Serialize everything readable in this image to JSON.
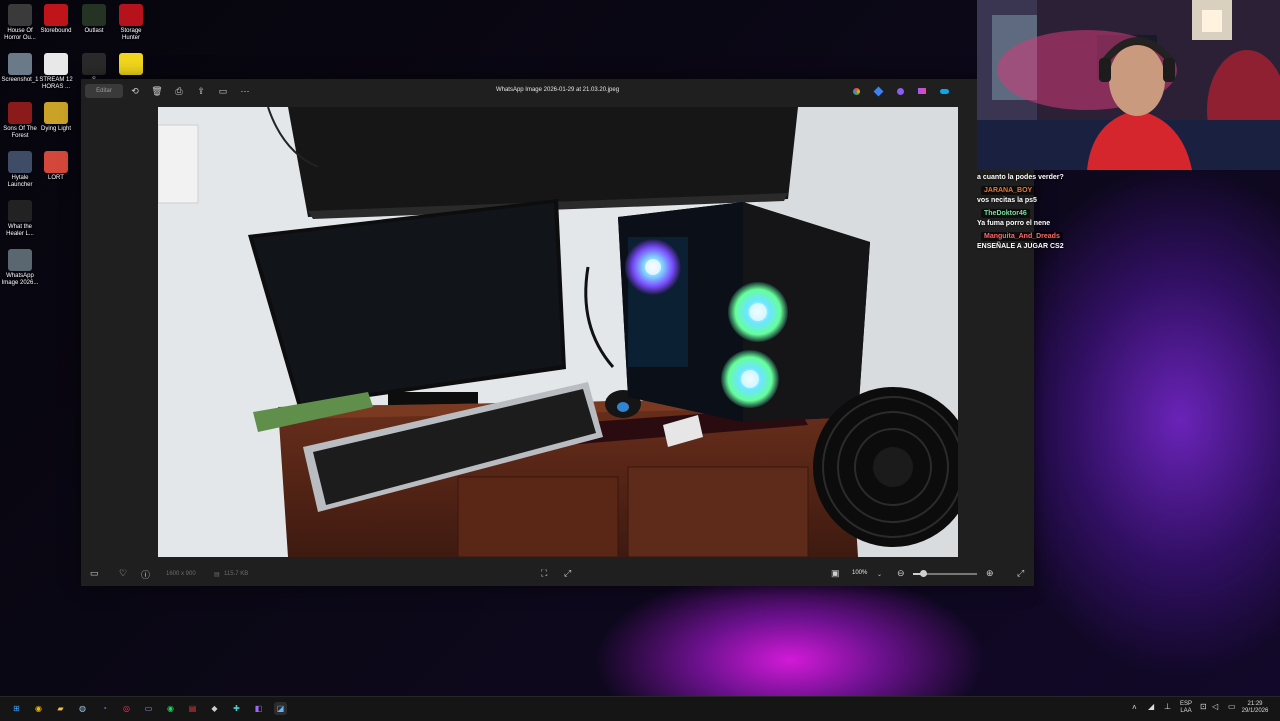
{
  "desktop": {
    "icons": [
      {
        "label": "House Of Horror Ou...",
        "icon": "house-of-horror-icon",
        "color": "#3a3a3a"
      },
      {
        "label": "Storebound",
        "icon": "storebound-icon",
        "color": "#c0141b"
      },
      {
        "label": "Outlast",
        "icon": "outlast-icon",
        "color": "#243324"
      },
      {
        "label": "Storage Hunter",
        "icon": "storage-hunter-icon",
        "color": "#b5121b"
      },
      {
        "label": "Screenshot_1",
        "icon": "screenshot-icon",
        "color": "#6b7a88"
      },
      {
        "label": "STREAM 12 HORAS ...",
        "icon": "document-icon",
        "color": "#e8e8e8"
      },
      {
        "label": "S",
        "icon": "app-icon",
        "color": "#2a2a2a"
      },
      {
        "label": "",
        "icon": "dc-icon",
        "color": "#f0d61c"
      },
      {
        "label": "Sons Of The Forest",
        "icon": "sons-of-the-forest-icon",
        "color": "#8b1a1a"
      },
      {
        "label": "Dying Light",
        "icon": "dying-light-icon",
        "color": "#c9a227"
      },
      {
        "label": "Hytale Launcher",
        "icon": "hytale-icon",
        "color": "#3f4c66"
      },
      {
        "label": "LORT",
        "icon": "lort-icon",
        "color": "#d4483b"
      },
      {
        "label": "What the Healer L...",
        "icon": "what-the-healer-icon",
        "color": "#222222"
      },
      {
        "label": "WhatsApp Image 2026...",
        "icon": "image-file-icon",
        "color": "#5a6670"
      }
    ]
  },
  "viewer": {
    "title": "WhatsApp Image 2026-01-29 at 21.03.20.jpeg",
    "edit_label": "Editar",
    "dimensions": "1600 x 900",
    "file_size": "115.7 KB",
    "zoom": "100%",
    "zoom_level": 0.15,
    "toolbar_icons": [
      "rotate-icon",
      "delete-icon",
      "print-icon",
      "share-icon",
      "slideshow-icon",
      "more-icon"
    ],
    "app_icons": [
      "copilot-icon",
      "designer-icon",
      "clipchamp-icon",
      "edit-app-icon",
      "onedrive-icon"
    ]
  },
  "chat": {
    "messages": [
      {
        "user": "",
        "text": "a cuanto la podes verder?",
        "user_color": ""
      },
      {
        "user": "JARANA_BOY",
        "text": "vos necitas la ps5",
        "user_color": "#e87a3a"
      },
      {
        "user": "TheDoktor46",
        "text": "Ya fuma porro el nene",
        "user_color": "#7be0a0"
      },
      {
        "user": "Manguita_And_Dreads",
        "text": "ENSEÑALE A JUGAR CS2",
        "user_color": "#ff6a6a"
      }
    ]
  },
  "taskbar": {
    "apps": [
      "windows-start-icon",
      "chrome-icon",
      "file-explorer-icon",
      "steam-icon",
      "discord-icon",
      "opera-gx-icon",
      "app-window-icon",
      "spotify-icon",
      "news-icon",
      "epic-icon",
      "xbox-icon",
      "app-purple-icon",
      "photos-icon"
    ],
    "lang_top": "ESP",
    "lang_bottom": "LAA",
    "time": "21:29",
    "date": "29/1/2026"
  }
}
